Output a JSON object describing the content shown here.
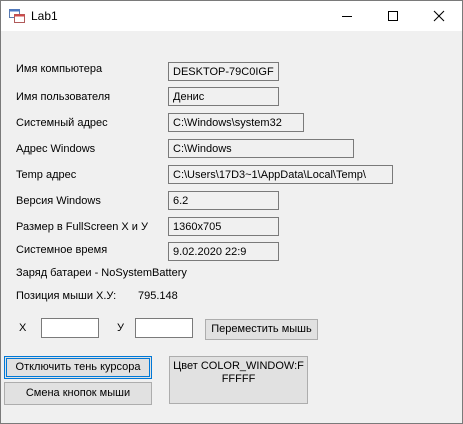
{
  "window": {
    "title": "Lab1"
  },
  "rows": [
    {
      "label": "Имя компьютера",
      "value": "DESKTOP-79C0IGF"
    },
    {
      "label": "Имя пользователя",
      "value": "Денис"
    },
    {
      "label": "Системный адрес",
      "value": "C:\\Windows\\system32"
    },
    {
      "label": "Адрес Windows",
      "value": "C:\\Windows"
    },
    {
      "label": "Temp адрес",
      "value": "C:\\Users\\17D3~1\\AppData\\Local\\Temp\\"
    },
    {
      "label": "Версия Windows",
      "value": "6.2"
    },
    {
      "label": "Размер в FullScreen X и У",
      "value": "1360x705"
    },
    {
      "label": "Системное время",
      "value": "9.02.2020   22:9"
    }
  ],
  "battery": {
    "label": "Заряд батареи - NoSystemBattery"
  },
  "mouse": {
    "label": "Позиция мыши X.У:",
    "value": "795.148"
  },
  "move": {
    "x_label": "X",
    "x_value": "",
    "y_label": "У",
    "y_value": "",
    "button": "Переместить мышь"
  },
  "buttons": {
    "cursor_shadow": "Отключить тень курсора",
    "swap_mouse": "Смена кнопок мыши",
    "color": "Цвет COLOR_WINDOW:FFFFFF"
  },
  "colors": {
    "focus": "#0078d7",
    "window_bg": "#f0f0f0"
  }
}
